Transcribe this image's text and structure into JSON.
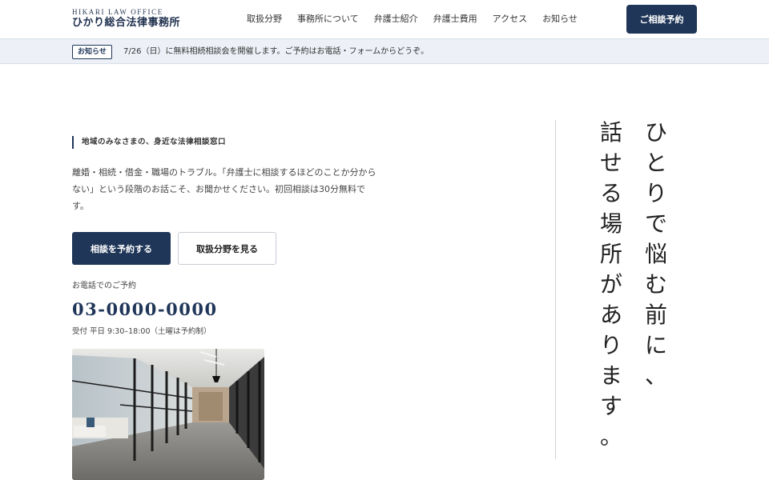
{
  "header": {
    "logo_en": "HIKARI LAW OFFICE",
    "logo_ja": "ひかり総合法律事務所",
    "nav": [
      "取扱分野",
      "事務所について",
      "弁護士紹介",
      "弁護士費用",
      "アクセス",
      "お知らせ"
    ],
    "cta_label": "ご相談予約"
  },
  "notice": {
    "badge": "お知らせ",
    "text": "7/26（日）に無料相続相談会を開催します。ご予約はお電話・フォームからどうぞ。"
  },
  "hero": {
    "eyebrow": "地域のみなさまの、身近な法律相談窓口",
    "lead": "離婚・相続・借金・職場のトラブル。「弁護士に相談するほどのことか分からない」という段階のお話こそ、お聞かせください。初回相談は30分無料です。",
    "primary_button": "相談を予約する",
    "secondary_button": "取扱分野を見る",
    "tel_label": "お電話でのご予約",
    "tel_number": "03-0000-0000",
    "tel_hours": "受付 平日 9:30–18:00（土曜は予約制）",
    "headline_line1": "ひとりで悩む前に、",
    "headline_line2": "話せる場所があります。"
  },
  "colors": {
    "brand": "#1f3658",
    "notice_bg": "#edf0f6"
  }
}
